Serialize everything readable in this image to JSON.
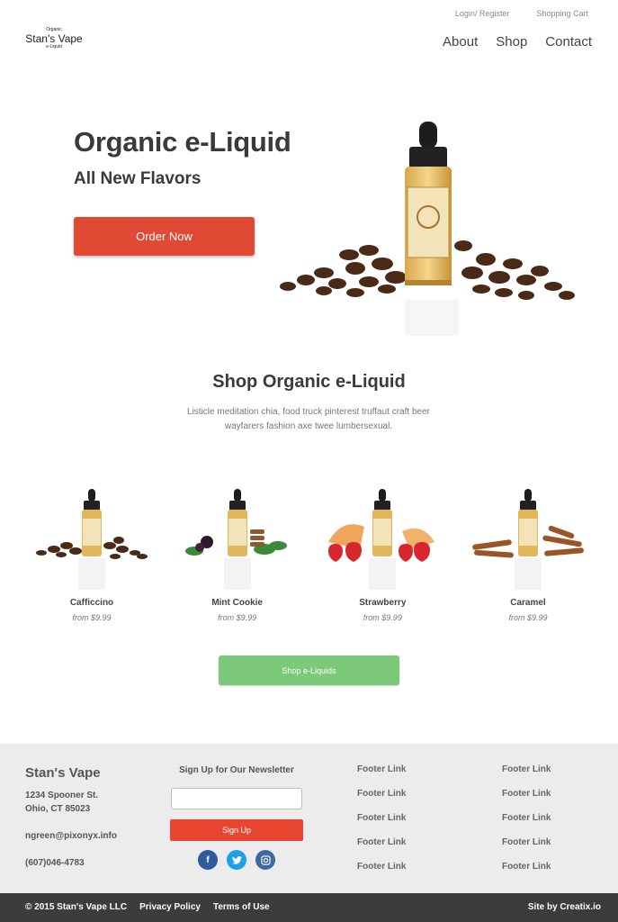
{
  "header": {
    "login_label": "Login/ Register",
    "cart_label": "Shopping Cart",
    "logo": {
      "small": "Organic",
      "main": "Stan's Vape",
      "sub": "e-Liquid"
    },
    "nav": [
      "About",
      "Shop",
      "Contact"
    ]
  },
  "hero": {
    "title": "Organic e-Liquid",
    "subtitle": "All New Flavors",
    "cta_label": "Order Now"
  },
  "shop": {
    "title": "Shop Organic e-Liquid",
    "description": "Listicle meditation chia, food truck pinterest truffaut craft beer wayfarers fashion axe twee lumbersexual.",
    "products": [
      {
        "name": "Cafficcino",
        "price": "from $9.99",
        "garnish": "coffee-beans"
      },
      {
        "name": "Mint Cookie",
        "price": "from $9.99",
        "garnish": "cookies-mint"
      },
      {
        "name": "Strawberry",
        "price": "from $9.99",
        "garnish": "strawberries"
      },
      {
        "name": "Caramel",
        "price": "from $9.99",
        "garnish": "cinnamon-sticks"
      }
    ],
    "cta_label": "Shop e-Liquids"
  },
  "footer": {
    "brand": "Stan's Vape",
    "address_line1": "1234 Spooner St.",
    "address_line2": "Ohio, CT 85023",
    "email": "ngreen@pixonyx.info",
    "phone": "(607)046-4783",
    "newsletter_title": "Sign Up for Our Newsletter",
    "newsletter_placeholder": "",
    "signup_label": "Sign Up",
    "links_col1": [
      "Footer Link",
      "Footer Link",
      "Footer Link",
      "Footer Link",
      "Footer Link"
    ],
    "links_col2": [
      "Footer Link",
      "Footer Link",
      "Footer Link",
      "Footer Link",
      "Footer Link"
    ],
    "socials": [
      "facebook-icon",
      "twitter-icon",
      "instagram-icon"
    ]
  },
  "bottombar": {
    "copyright": "© 2015 Stan's Vape LLC",
    "privacy": "Privacy Policy",
    "terms": "Terms of Use",
    "credit": "Site by Creatix.io"
  },
  "colors": {
    "order_button": "#e04a34",
    "shop_button": "#7dc97a",
    "signup_button": "#e84631",
    "footer_bg": "#ececec",
    "bottombar_bg": "#3c3c3c"
  }
}
